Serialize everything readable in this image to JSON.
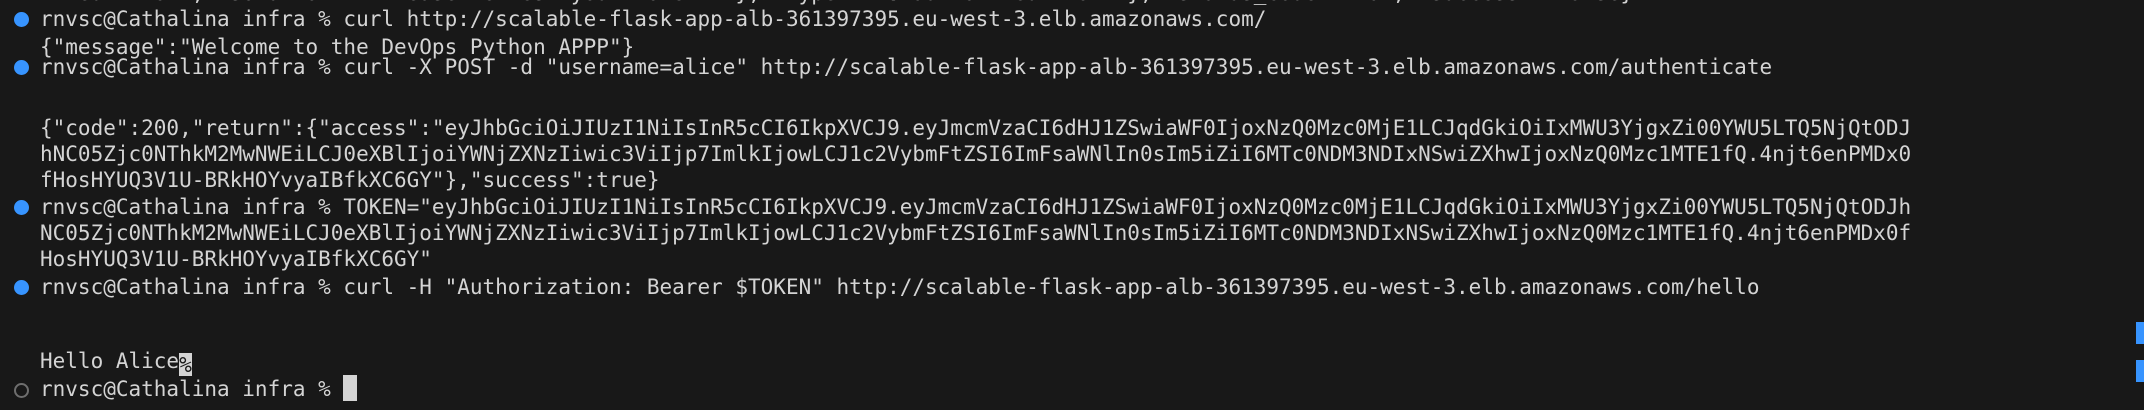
{
  "terminal": {
    "prev_output_tail": "fized Error\", \"solution\": \"Please refresh your token.\" }, \"type\": \"UnauthorizedError\" }, \"status_code\": 401, \"success\": false}",
    "lines": [
      {
        "kind": "cmd",
        "text": "rnvsc@Cathalina infra % curl http://scalable-flask-app-alb-361397395.eu-west-3.elb.amazonaws.com/"
      },
      {
        "kind": "out",
        "text": "{\"message\":\"Welcome to the DevOps Python APPP\"}"
      },
      {
        "kind": "cmd",
        "text": "rnvsc@Cathalina infra % curl -X POST -d \"username=alice\" http://scalable-flask-app-alb-361397395.eu-west-3.elb.amazonaws.com/authenticate"
      },
      {
        "kind": "blank",
        "text": ""
      },
      {
        "kind": "out",
        "text": "{\"code\":200,\"return\":{\"access\":\"eyJhbGciOiJIUzI1NiIsInR5cCI6IkpXVCJ9.eyJmcmVzaCI6dHJ1ZSwiaWF0IjoxNzQ0Mzc0MjE1LCJqdGkiOiIxMWU3YjgxZi00YWU5LTQ5NjQtODJ"
      },
      {
        "kind": "out",
        "text": "hNC05Zjc0NThkM2MwNWEiLCJ0eXBlIjoiYWNjZXNzIiwic3ViIjp7ImlkIjowLCJ1c2VybmFtZSI6ImFsaWNlIn0sIm5iZiI6MTc0NDM3NDIxNSwiZXhwIjoxNzQ0Mzc1MTE1fQ.4njt6enPMDx0"
      },
      {
        "kind": "out",
        "text": "fHosHYUQ3V1U-BRkHOYvyaIBfkXC6GY\"},\"success\":true}"
      },
      {
        "kind": "cmd",
        "text": "rnvsc@Cathalina infra % TOKEN=\"eyJhbGciOiJIUzI1NiIsInR5cCI6IkpXVCJ9.eyJmcmVzaCI6dHJ1ZSwiaWF0IjoxNzQ0Mzc0MjE1LCJqdGkiOiIxMWU3YjgxZi00YWU5LTQ5NjQtODJh"
      },
      {
        "kind": "out",
        "text": "NC05Zjc0NThkM2MwNWEiLCJ0eXBlIjoiYWNjZXNzIiwic3ViIjp7ImlkIjowLCJ1c2VybmFtZSI6ImFsaWNlIn0sIm5iZiI6MTc0NDM3NDIxNSwiZXhwIjoxNzQ0Mzc1MTE1fQ.4njt6enPMDx0f"
      },
      {
        "kind": "out",
        "text": "HosHYUQ3V1U-BRkHOYvyaIBfkXC6GY\""
      },
      {
        "kind": "cmd",
        "text": "rnvsc@Cathalina infra % curl -H \"Authorization: Bearer $TOKEN\" http://scalable-flask-app-alb-361397395.eu-west-3.elb.amazonaws.com/hello"
      },
      {
        "kind": "blank",
        "text": ""
      },
      {
        "kind": "out",
        "text": "Hello Alice"
      },
      {
        "kind": "prompt",
        "text": "rnvsc@Cathalina infra % "
      }
    ],
    "eol_marker": "%",
    "colors": {
      "background": "#181818",
      "text": "#d4d4d4",
      "success_dot": "#3794ff",
      "pending_dot": "#6e6e6e"
    }
  }
}
